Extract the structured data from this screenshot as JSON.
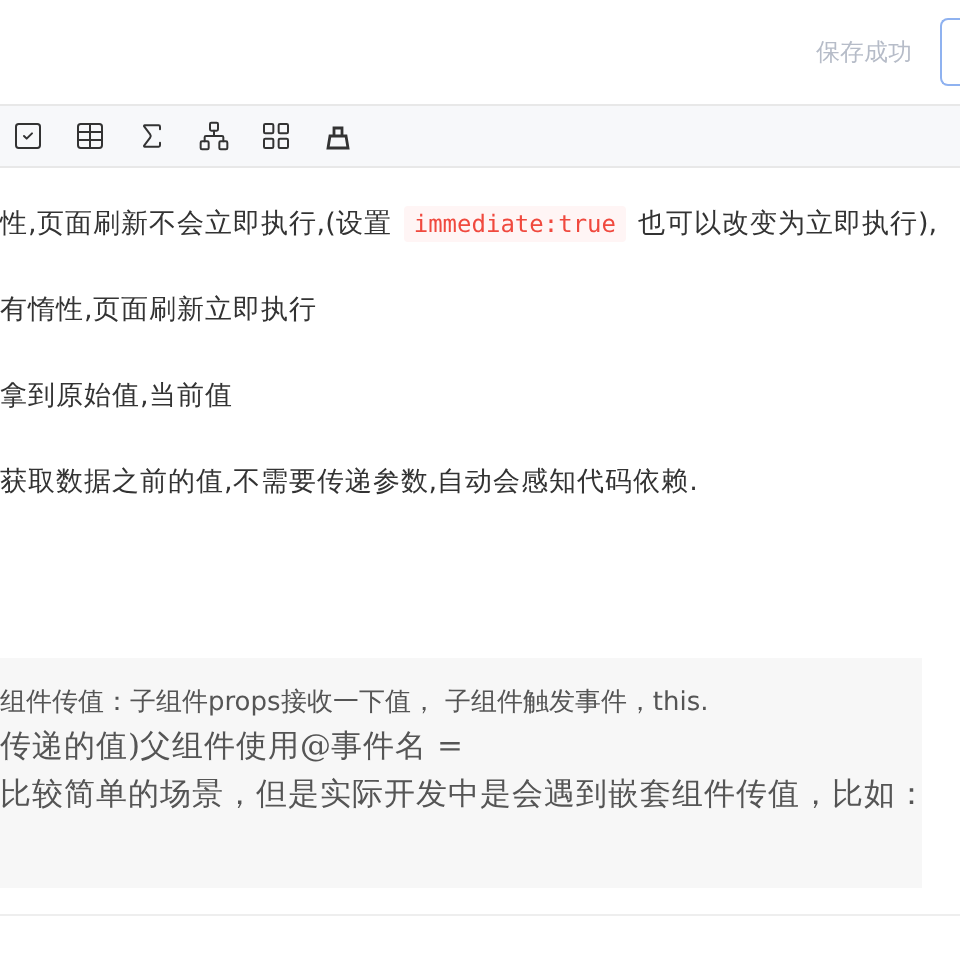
{
  "header": {
    "status": "保存成功"
  },
  "toolbar": {
    "icons": [
      {
        "kind": "checkbox"
      },
      {
        "kind": "table"
      },
      {
        "kind": "sigma"
      },
      {
        "kind": "hierarchy"
      },
      {
        "kind": "grid"
      },
      {
        "kind": "container"
      }
    ]
  },
  "paragraphs": [
    {
      "parts": [
        {
          "kind": "text",
          "text": "性,页面刷新不会立即执行,(设置"
        },
        {
          "kind": "code",
          "text": "immediate:true"
        },
        {
          "kind": "text",
          "text": "也可以改变为立即执行),"
        }
      ]
    },
    {
      "parts": [
        {
          "kind": "text",
          "text": "有惰性,页面刷新立即执行"
        }
      ]
    },
    {
      "parts": [
        {
          "kind": "text",
          "text": "拿到原始值,当前值"
        }
      ]
    },
    {
      "parts": [
        {
          "kind": "text",
          "text": "获取数据之前的值,不需要传递参数,自动会感知代码依赖."
        }
      ]
    }
  ],
  "quote": {
    "lines": [
      {
        "kind": "sans",
        "text": "组件传值：子组件props接收一下值， 子组件触发事件，this."
      },
      {
        "kind": "serif",
        "text": "传递的值)父组件使用@事件名 ="
      },
      {
        "kind": "serif",
        "text": "比较简单的场景，但是实际开发中是会遇到嵌套组件传值，比如："
      }
    ]
  }
}
